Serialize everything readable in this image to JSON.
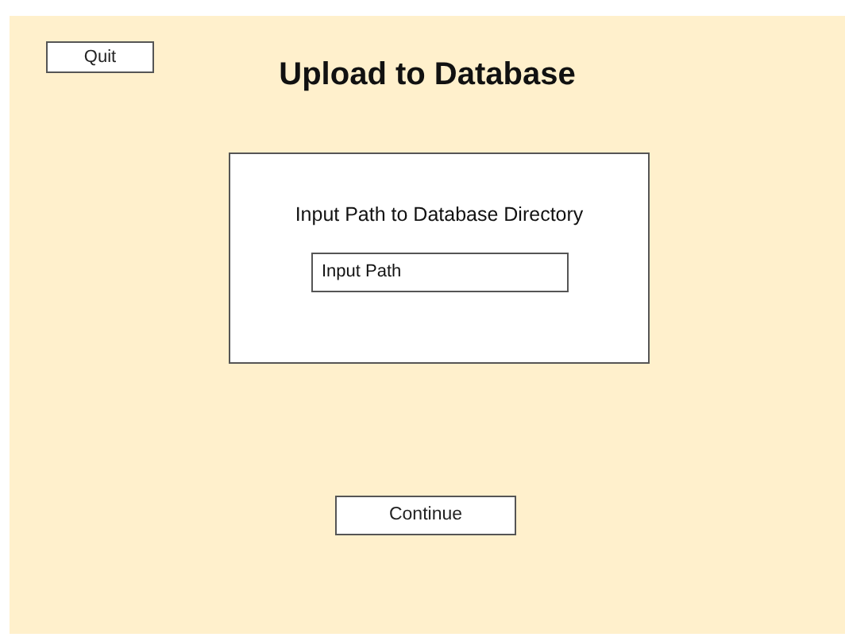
{
  "quit_button": "Quit",
  "title": "Upload to Database",
  "panel": {
    "label": "Input Path to Database Directory",
    "path_field": {
      "placeholder": "Input Path"
    }
  },
  "continue_button": "Continue"
}
